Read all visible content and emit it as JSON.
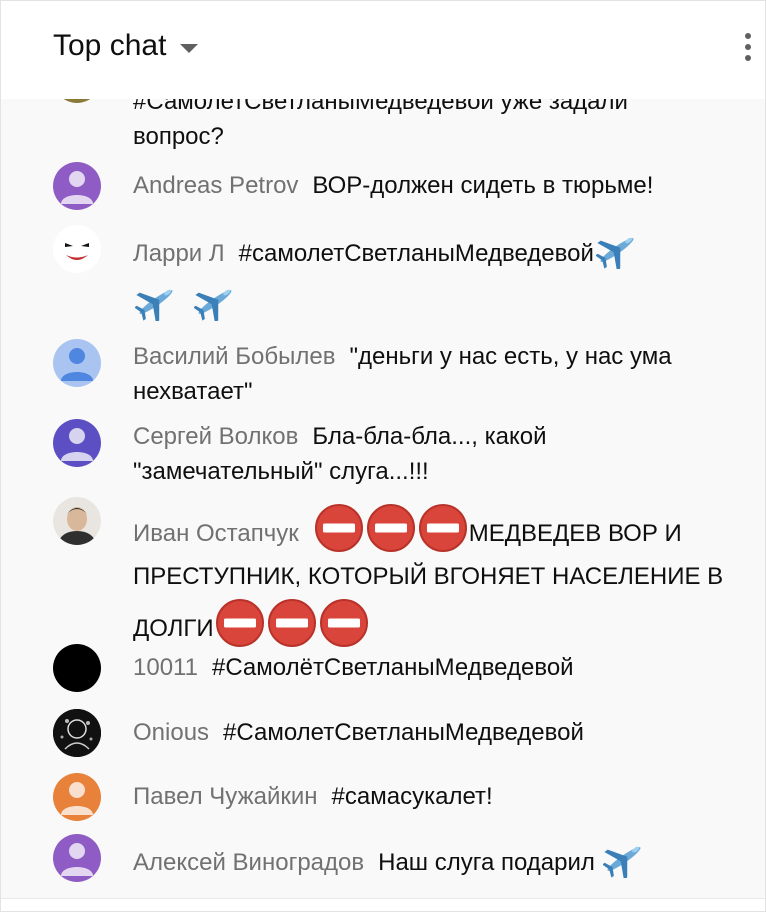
{
  "header": {
    "title": "Top chat",
    "dropdown_icon": "caret-down-icon",
    "menu_icon": "more-vertical-icon"
  },
  "messages": [
    {
      "author": "",
      "text_line1": "#СамолетСветланыМедведевой уже задали",
      "text_line2": "вопрос?",
      "avatar": {
        "type": "partial",
        "color": "#8a7a3a"
      }
    },
    {
      "author": "Andreas Petrov",
      "text": "ВОР-должен сидеть в тюрьме!",
      "avatar": {
        "type": "default",
        "color": "#8e5cc4"
      }
    },
    {
      "author": "Ларри Л",
      "text": "#самолетСветланыМедведевой",
      "avatar": {
        "type": "joker",
        "color": "#ffffff"
      },
      "emoji_icon": "airplane-emoji-icon"
    },
    {
      "author": "Василий Бобылев",
      "text": "\"деньги у нас есть, у нас ума нехватает\"",
      "avatar": {
        "type": "default",
        "color": "#4f86e0",
        "bg": "#aac4f2"
      }
    },
    {
      "author": "Сергей Волков",
      "text": "Бла-бла-бла..., какой \"замечательный\" слуга...!!!",
      "avatar": {
        "type": "default",
        "color": "#5c4fc4"
      }
    },
    {
      "author": "Иван Остапчук",
      "text": "МЕДВЕДЕВ ВОР И ПРЕСТУПНИК, КОТОРЫЙ ВГОНЯЕТ НАСЕЛЕНИЕ В ДОЛГИ",
      "avatar": {
        "type": "photo",
        "color": "#3a3a3a"
      },
      "emoji_icon": "no-entry-emoji-icon"
    },
    {
      "author": "10011",
      "text": "#СамолётСветланыМедведевой",
      "avatar": {
        "type": "black",
        "color": "#000000"
      }
    },
    {
      "author": "Onious",
      "text": "#СамолетСветланыМедведевой",
      "avatar": {
        "type": "sketch",
        "color": "#111111"
      }
    },
    {
      "author": "Павел Чужайкин",
      "text": "#самасукалет!",
      "avatar": {
        "type": "default",
        "color": "#e8813a"
      }
    },
    {
      "author": "Алексей Виноградов",
      "text": "Наш слуга подарил",
      "avatar": {
        "type": "default",
        "color": "#8e5cc4"
      },
      "emoji_icon": "airplane-emoji-icon"
    }
  ]
}
